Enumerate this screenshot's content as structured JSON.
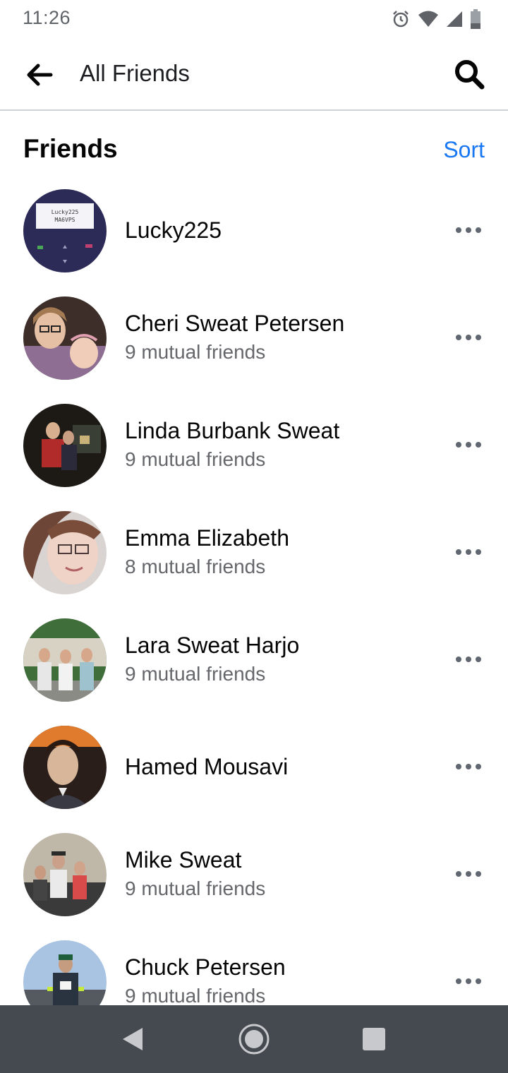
{
  "status_bar": {
    "time": "11:26",
    "icons": [
      "alarm-icon",
      "wifi-icon",
      "signal-icon",
      "battery-icon"
    ]
  },
  "header": {
    "title": "All Friends",
    "back_icon": "arrow-left-icon",
    "search_icon": "search-icon"
  },
  "section": {
    "title": "Friends",
    "sort_label": "Sort"
  },
  "friends": [
    {
      "name": "Lucky225",
      "mutual": ""
    },
    {
      "name": "Cheri Sweat Petersen",
      "mutual": "9 mutual friends"
    },
    {
      "name": "Linda Burbank Sweat",
      "mutual": "9 mutual friends"
    },
    {
      "name": "Emma Elizabeth",
      "mutual": "8 mutual friends"
    },
    {
      "name": "Lara Sweat Harjo",
      "mutual": "9 mutual friends"
    },
    {
      "name": "Hamed Mousavi",
      "mutual": ""
    },
    {
      "name": "Mike Sweat",
      "mutual": "9 mutual friends"
    },
    {
      "name": "Chuck Petersen",
      "mutual": "9 mutual friends"
    }
  ],
  "avatar_sign_text": [
    "Lucky225",
    "MA6VPS"
  ],
  "nav": {
    "icons": [
      "back-triangle-icon",
      "home-circle-icon",
      "recents-square-icon"
    ]
  },
  "colors": {
    "accent": "#1877f2",
    "nav_bar": "#454a51",
    "secondary_text": "#65676b"
  }
}
